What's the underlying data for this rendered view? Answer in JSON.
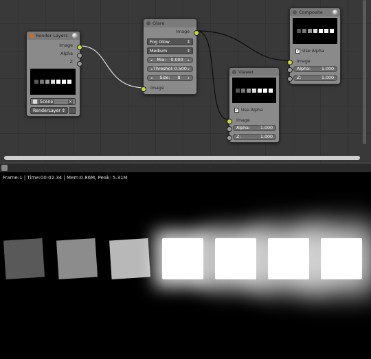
{
  "nodes": {
    "render_layers": {
      "title": "Render Layers",
      "outputs": [
        "Image",
        "Alpha",
        "Z"
      ],
      "scene_label": "Scene",
      "layer_label": "RenderLayer"
    },
    "glare": {
      "title": "Glare",
      "output": "Image",
      "type_value": "Fog Glow",
      "quality_value": "Medium",
      "mix_label": "Mix:",
      "mix_value": "0.000",
      "threshold_label": "Threshol:",
      "threshold_value": "0.500",
      "size_label": "Size:",
      "size_value": "8",
      "input": "Image"
    },
    "viewer": {
      "title": "Viewer",
      "use_alpha": "Use Alpha",
      "input_image": "Image",
      "alpha_label": "Alpha:",
      "alpha_value": "1.000",
      "z_label": "Z:",
      "z_value": "1.000"
    },
    "composite": {
      "title": "Composite",
      "use_alpha": "Use Alpha",
      "input_image": "Image",
      "alpha_label": "Alpha:",
      "alpha_value": "1.000",
      "z_label": "Z:",
      "z_value": "1.000"
    }
  },
  "render": {
    "info": "Frame:1 | Time:00:02.34 | Mem:0.86M, Peak: 5.31M",
    "cube_brightness": [
      0.35,
      0.55,
      0.72,
      1.0,
      1.0,
      1.0,
      1.0
    ]
  }
}
